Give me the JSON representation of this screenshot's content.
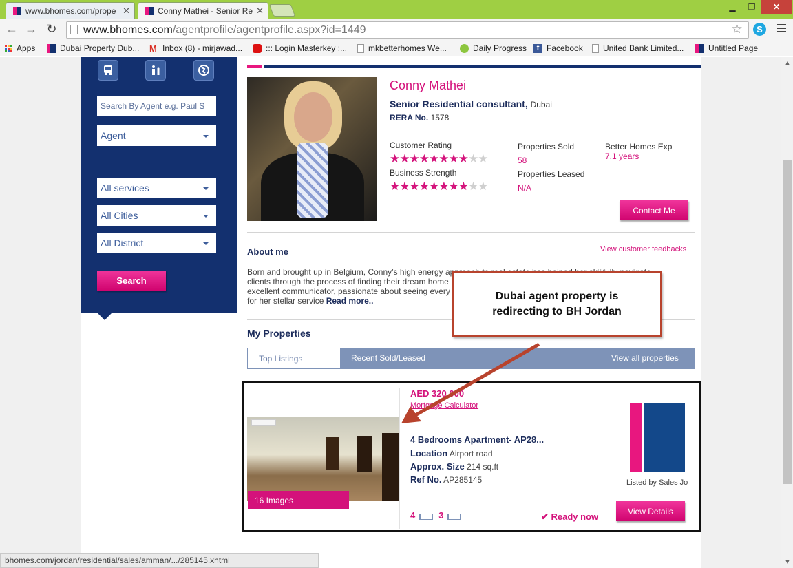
{
  "browser": {
    "tabs": [
      {
        "title": "www.bhomes.com/prope",
        "active": false
      },
      {
        "title": "Conny Mathei - Senior Re",
        "active": true
      }
    ],
    "url_host": "www.bhomes.com",
    "url_path": "/agentprofile/agentprofile.aspx?id=1449",
    "bookmarks": [
      {
        "label": "Apps",
        "icon": "apps-grid-icon"
      },
      {
        "label": "Dubai Property Dub...",
        "icon": "bhomes-favicon"
      },
      {
        "label": "Inbox (8) - mirjawad...",
        "icon": "gmail-icon"
      },
      {
        "label": "::: Login Masterkey :...",
        "icon": "masterkey-icon"
      },
      {
        "label": "mkbetterhomes We...",
        "icon": "page-icon"
      },
      {
        "label": "Daily Progress",
        "icon": "cloud-icon"
      },
      {
        "label": "Facebook",
        "icon": "facebook-icon"
      },
      {
        "label": "United Bank Limited...",
        "icon": "page-icon"
      },
      {
        "label": "Untitled Page",
        "icon": "bhomes-favicon"
      }
    ],
    "status_url": "bhomes.com/jordan/residential/sales/amman/.../285145.xhtml"
  },
  "sidebar": {
    "icons": [
      "transport-icon",
      "family-icon",
      "globe-icon"
    ],
    "search_placeholder": "Search By Agent e.g. Paul S",
    "type_select": "Agent",
    "services_select": "All services",
    "cities_select": "All Cities",
    "district_select": "All District",
    "search_button": "Search"
  },
  "agent": {
    "name": "Conny Mathei",
    "title": "Senior Residential consultant,",
    "city": "Dubai",
    "rera_label": "RERA No.",
    "rera_value": "1578",
    "customer_rating_label": "Customer Rating",
    "customer_rating": 8,
    "business_strength_label": "Business Strength",
    "business_strength": 8,
    "rating_max": 10,
    "properties_sold_label": "Properties Sold",
    "properties_sold": "58",
    "properties_leased_label": "Properties Leased",
    "properties_leased": "N/A",
    "exp_label": "Better Homes Exp",
    "exp_value": "7.1 years",
    "contact_button": "Contact Me"
  },
  "about": {
    "heading": "About me",
    "feedback_link": "View customer feedbacks",
    "text_lines": [
      "Born and brought up in Belgium, Conny’s high energy approach to real estate has helped her skillfully navigate",
      "clients through the process of finding their dream home",
      "excellent communicator, passionate about seeing every",
      "for her stellar service"
    ],
    "read_more": "Read more.."
  },
  "properties": {
    "heading": "My Properties",
    "tabs": [
      "Top Listings",
      "Recent Sold/Leased"
    ],
    "view_all": "View all properties",
    "listing": {
      "price": "AED 320,000",
      "mortgage_link": "Mortgage Calculator",
      "title": "4 Bedrooms Apartment- AP28...",
      "location_label": "Location",
      "location": "Airport road",
      "size_label": "Approx. Size",
      "size": "214 sq.ft",
      "ref_label": "Ref No.",
      "ref": "AP285145",
      "images_count": "16 Images",
      "bedrooms": "4",
      "bathrooms": "3",
      "ready": "✔ Ready now",
      "listed_by": "Listed by Sales Jo",
      "details_button": "View Details"
    }
  },
  "annotation": {
    "text": "Dubai agent property is redirecting to BH Jordan",
    "color": "#b8432d"
  },
  "colors": {
    "brand_pink": "#d4127b",
    "brand_navy": "#13306f",
    "tab_bar": "#7e93b8"
  }
}
